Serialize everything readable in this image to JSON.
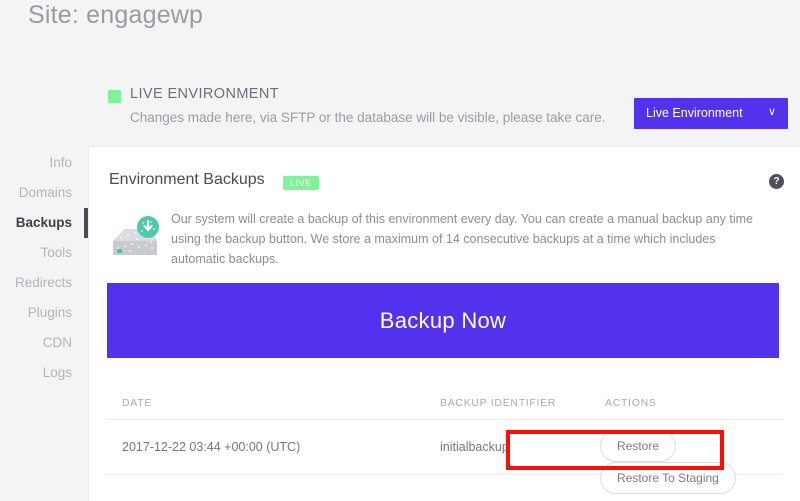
{
  "header": {
    "site_label": "Site: engagewp"
  },
  "environment": {
    "badge_icon": "green-square-icon",
    "title": "LIVE ENVIRONMENT",
    "subtitle": "Changes made here, via SFTP or the database will be visible, please take care.",
    "selector_value": "Live Environment",
    "selector_chevron": "∨",
    "accent_color": "#5331ed",
    "live_color": "#7ef39a"
  },
  "sidebar": {
    "items": [
      {
        "label": "Info",
        "active": false
      },
      {
        "label": "Domains",
        "active": false
      },
      {
        "label": "Backups",
        "active": true
      },
      {
        "label": "Tools",
        "active": false
      },
      {
        "label": "Redirects",
        "active": false
      },
      {
        "label": "Plugins",
        "active": false
      },
      {
        "label": "CDN",
        "active": false
      },
      {
        "label": "Logs",
        "active": false
      }
    ]
  },
  "card": {
    "title": "Environment Backups",
    "badge": "LIVE",
    "help_icon": "question-mark-icon",
    "help_glyph": "?",
    "disk_icon": "backup-disk-download-icon",
    "description": "Our system will create a backup of this environment every day. You can create a manual backup any time using the backup button. We store a maximum of 14 consecutive backups at a time which includes automatic backups.",
    "backup_now_label": "Backup Now"
  },
  "table": {
    "columns": [
      "DATE",
      "BACKUP IDENTIFIER",
      "ACTIONS"
    ],
    "rows": [
      {
        "date": "2017-12-22 03:44 +00:00 (UTC)",
        "identifier": "initialbackup",
        "actions": [
          "Restore",
          "Restore To Staging"
        ]
      }
    ]
  },
  "annotation": {
    "type": "red-rectangle-highlight",
    "color": "#fb0d08",
    "target": "restore-actions"
  }
}
